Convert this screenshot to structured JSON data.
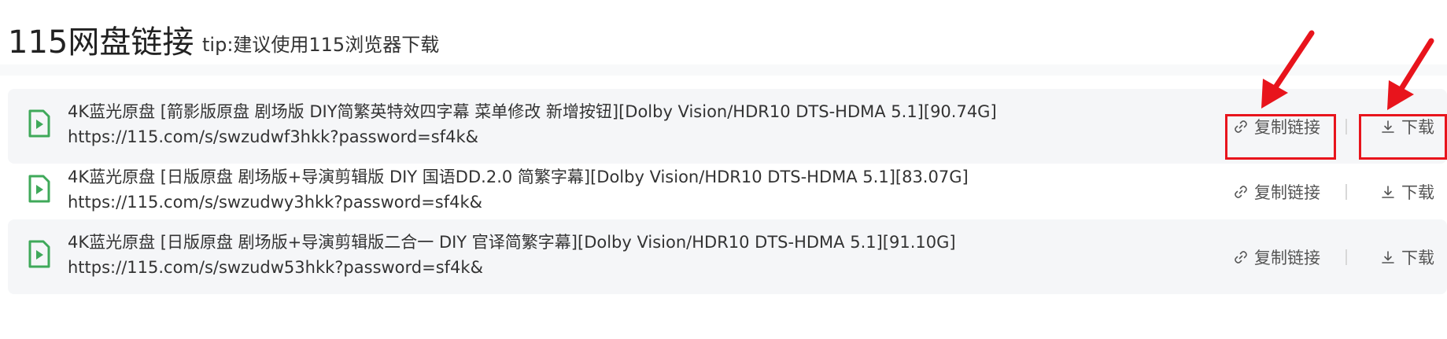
{
  "header": {
    "title": "115网盘链接",
    "tip": "tip:建议使用115浏览器下载"
  },
  "rows": [
    {
      "title": "4K蓝光原盘 [箭影版原盘 剧场版 DIY简繁英特效四字幕 菜单修改 新增按钮][Dolby Vision/HDR10 DTS-HDMA 5.1][90.74G]",
      "url": "https://115.com/s/swzudwf3hkk?password=sf4k&",
      "copy_label": "复制链接",
      "download_label": "下载"
    },
    {
      "title": "4K蓝光原盘 [日版原盘 剧场版+导演剪辑版 DIY 国语DD.2.0 简繁字幕][Dolby Vision/HDR10 DTS-HDMA 5.1][83.07G]",
      "url": "https://115.com/s/swzudwy3hkk?password=sf4k&",
      "copy_label": "复制链接",
      "download_label": "下载"
    },
    {
      "title": "4K蓝光原盘 [日版原盘 剧场版+导演剪辑版二合一 DIY 官译简繁字幕][Dolby Vision/HDR10 DTS-HDMA 5.1][91.10G]",
      "url": "https://115.com/s/swzudw53hkk?password=sf4k&",
      "copy_label": "复制链接",
      "download_label": "下载"
    }
  ],
  "icons": {
    "file": "video-file-icon",
    "copy": "link-icon",
    "download": "download-icon"
  },
  "colors": {
    "file_icon_green": "#3fa95a",
    "highlight_red": "#e8141c",
    "row_background": "#f5f6f8"
  }
}
